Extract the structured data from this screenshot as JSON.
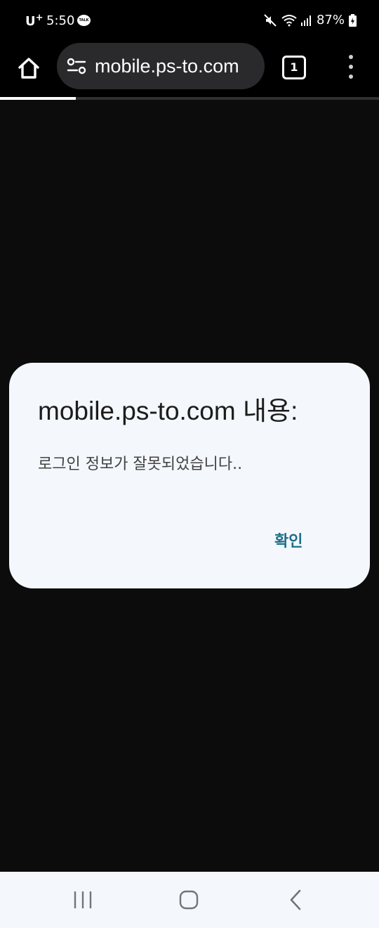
{
  "status_bar": {
    "carrier": "U",
    "carrier_sup": "+",
    "time": "5:50",
    "notification_icon": "talk-icon",
    "notification_text": "TALK",
    "battery_percent": "87%"
  },
  "browser": {
    "url": "mobile.ps-to.com",
    "tab_count": "1",
    "load_progress": 0.2
  },
  "dialog": {
    "title": "mobile.ps-to.com 내용:",
    "message": "로그인 정보가 잘못되었습니다..",
    "ok_label": "확인"
  },
  "colors": {
    "page_background": "#0c0c0c",
    "dialog_background": "#f4f7fc",
    "dialog_button": "#1e6e86",
    "omnibox_background": "#2a2a2c",
    "nav_bar_background": "#f4f7fc"
  },
  "icons": {
    "home": "home-icon",
    "site_settings": "tune-icon",
    "menu": "more-vert-icon",
    "mute": "mute-icon",
    "wifi": "wifi-icon",
    "signal": "signal-icon",
    "battery": "battery-charging-icon",
    "nav_recent": "recent-apps-icon",
    "nav_home": "home-nav-icon",
    "nav_back": "back-icon"
  }
}
